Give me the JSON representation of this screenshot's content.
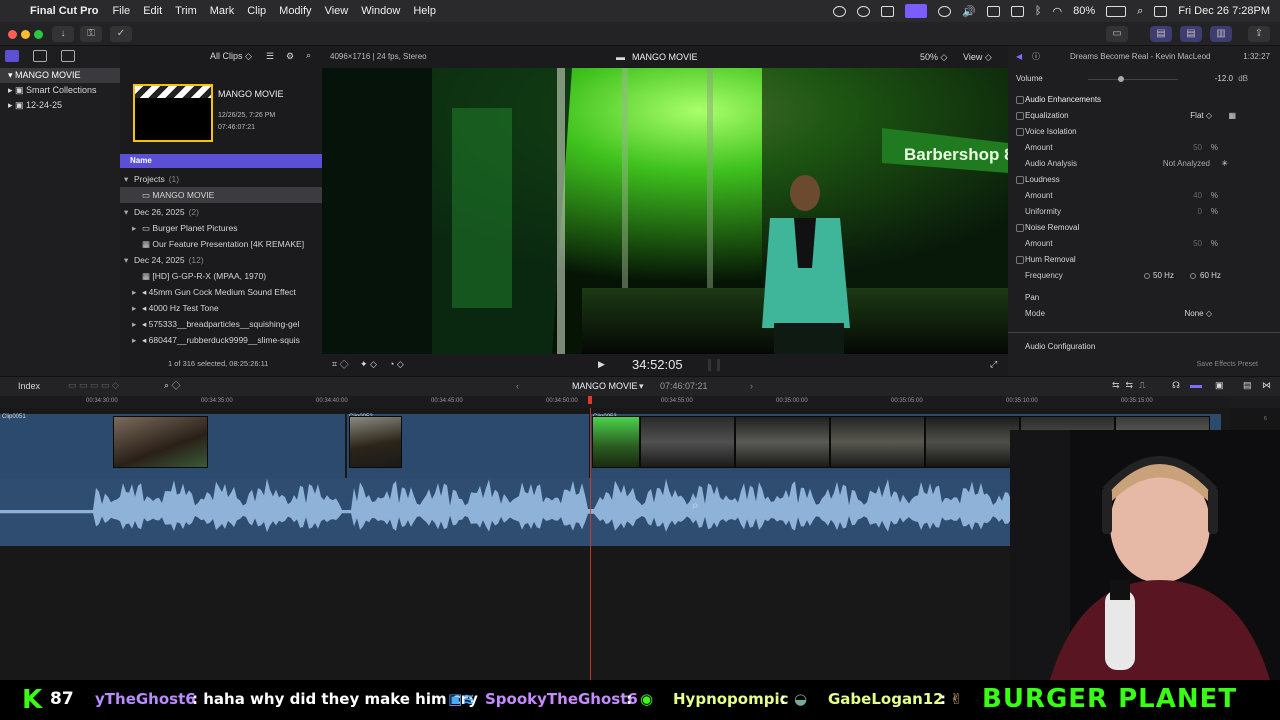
{
  "menubar": {
    "app": "Final Cut Pro",
    "items": [
      "File",
      "Edit",
      "Trim",
      "Mark",
      "Clip",
      "Modify",
      "View",
      "Window",
      "Help"
    ],
    "battery": "80%",
    "datetime": "Fri Dec 26  7:28PM"
  },
  "sidebar": {
    "items": [
      {
        "label": "MANGO MOVIE"
      },
      {
        "label": "Smart Collections"
      },
      {
        "label": "12-24-25"
      }
    ]
  },
  "browser": {
    "filter": "All Clips",
    "project_card": {
      "name": "MANGO MOVIE",
      "date": "12/26/25, 7:26 PM",
      "duration": "07:46:07:21"
    },
    "name_header": "Name",
    "groups": [
      {
        "label": "Projects",
        "count": "(1)",
        "items": [
          "MANGO MOVIE"
        ]
      },
      {
        "label": "Dec 26, 2025",
        "count": "(2)",
        "items": [
          "Burger Planet Pictures",
          "Our Feature Presentation [4K REMAKE]"
        ]
      },
      {
        "label": "Dec 24, 2025",
        "count": "(12)",
        "items": [
          "[HD] G-GP-R-X (MPAA, 1970)",
          "45mm Gun Cock Medium Sound Effect",
          "4000 Hz Test Tone",
          "575333__breadparticles__squishing-gel",
          "680447__rubberduck9999__slime-squis"
        ]
      }
    ],
    "selection_status": "1 of 316 selected, 08:25:26:11"
  },
  "viewer": {
    "format": "4096×1716 | 24 fps, Stereo",
    "title": "MANGO MOVIE",
    "zoom": "50%",
    "view_menu": "View",
    "timecode": "34:52:05",
    "sign_text": "Barbershop 8"
  },
  "inspector": {
    "title": "Dreams Become Real - Kevin MacLeod",
    "duration": "1:32:27",
    "volume_label": "Volume",
    "volume_value": "-12.0",
    "volume_unit": "dB",
    "audio_enhancements": "Audio Enhancements",
    "equalization": "Equalization",
    "eq_value": "Flat",
    "voice_isolation": "Voice Isolation",
    "amount": "Amount",
    "va_amount": "50",
    "percent": "%",
    "audio_analysis": "Audio Analysis",
    "analysis_value": "Not Analyzed",
    "loudness": "Loudness",
    "loud_amount": "40",
    "uniformity": "Uniformity",
    "uniformity_value": "0",
    "noise_removal": "Noise Removal",
    "noise_amount": "50",
    "hum_removal": "Hum Removal",
    "frequency": "Frequency",
    "freq50": "50 Hz",
    "freq60": "60 Hz",
    "pan": "Pan",
    "mode": "Mode",
    "mode_value": "None",
    "audio_config": "Audio Configuration",
    "save_preset": "Save Effects Preset"
  },
  "timeline": {
    "index": "Index",
    "project": "MANGO MOVIE",
    "duration": "07:46:07:21",
    "ruler": [
      "00:34:30:00",
      "00:34:35:00",
      "00:34:40:00",
      "00:34:45:00",
      "00:34:50:00",
      "00:34:55:00",
      "00:35:00:00",
      "00:35:05:00",
      "00:35:10:00",
      "00:35:15:00"
    ],
    "clips": [
      "Clip0051",
      "Clip0052",
      "Clip0053"
    ],
    "meter_labels": [
      "6",
      "0",
      "-6"
    ]
  },
  "stream_bar": {
    "k_count": "87",
    "chat": [
      {
        "user": "yTheGhost6",
        "msg": ": haha why did they make him cry"
      },
      {
        "user": "SpookyTheGhost6",
        "msg": ":"
      },
      {
        "user": "Hypnopompic",
        "msg": ":"
      },
      {
        "user": "GabeLogan12",
        "msg": ":"
      }
    ],
    "brand": "BURGER PLANET"
  },
  "colors": {
    "accent": "#5b4fd6",
    "playhead": "#e03a2a",
    "clip": "#2c4a6e",
    "brand": "#39ff14"
  }
}
